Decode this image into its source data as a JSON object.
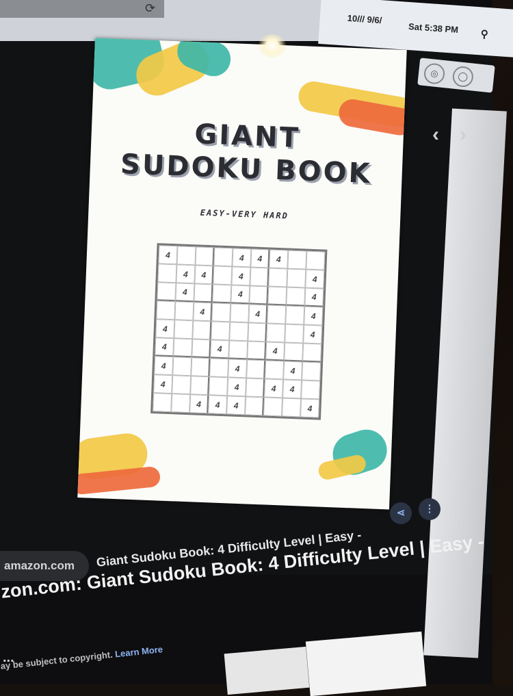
{
  "menubar": {
    "clock": "10/// 9/6/",
    "date": "Sat 5:38 PM",
    "search_icon": "search-icon"
  },
  "viewer": {
    "nav_prev": "‹",
    "nav_next": "›",
    "share_icon": "share-icon",
    "menu_icon": "more-vertical-icon"
  },
  "cover": {
    "top_text": "",
    "title_line1": "GIANT",
    "title_line2": "SUDOKU BOOK",
    "subtitle_line1": "",
    "subtitle_line2": "EASY-VERY HARD",
    "side_note": "",
    "footer_text": "",
    "grid_rows": [
      [
        "4",
        "",
        "",
        "",
        "4",
        "4",
        "4",
        "",
        ""
      ],
      [
        "",
        "4",
        "4",
        "",
        "4",
        "",
        "",
        "",
        "4"
      ],
      [
        "",
        "4",
        "",
        "",
        "4",
        "",
        "",
        "",
        "4"
      ],
      [
        "",
        "",
        "4",
        "",
        "",
        "4",
        "",
        "",
        "4"
      ],
      [
        "4",
        "",
        "",
        "",
        "",
        "",
        "",
        "",
        "4"
      ],
      [
        "4",
        "",
        "",
        "4",
        "",
        "",
        "4",
        "",
        ""
      ],
      [
        "4",
        "",
        "",
        "",
        "4",
        "",
        "",
        "4",
        ""
      ],
      [
        "4",
        "",
        "",
        "",
        "4",
        "",
        "4",
        "4",
        ""
      ],
      [
        "",
        "",
        "4",
        "4",
        "4",
        "",
        "",
        "",
        "4"
      ]
    ]
  },
  "result": {
    "source": "amazon.com",
    "title": "zon.com: Giant Sudoku Book: 4 Difficulty Level | Easy -",
    "heading": "Giant Sudoku Book: 4 Difficulty Level | Easy -",
    "ellipsis": "...",
    "copyright_text": "ay be subject to copyright.",
    "learn_more": "Learn More"
  },
  "colors": {
    "teal": "#3fb7a8",
    "yellow": "#f2c945",
    "orange": "#ee6a3c",
    "link": "#8db4f2"
  }
}
